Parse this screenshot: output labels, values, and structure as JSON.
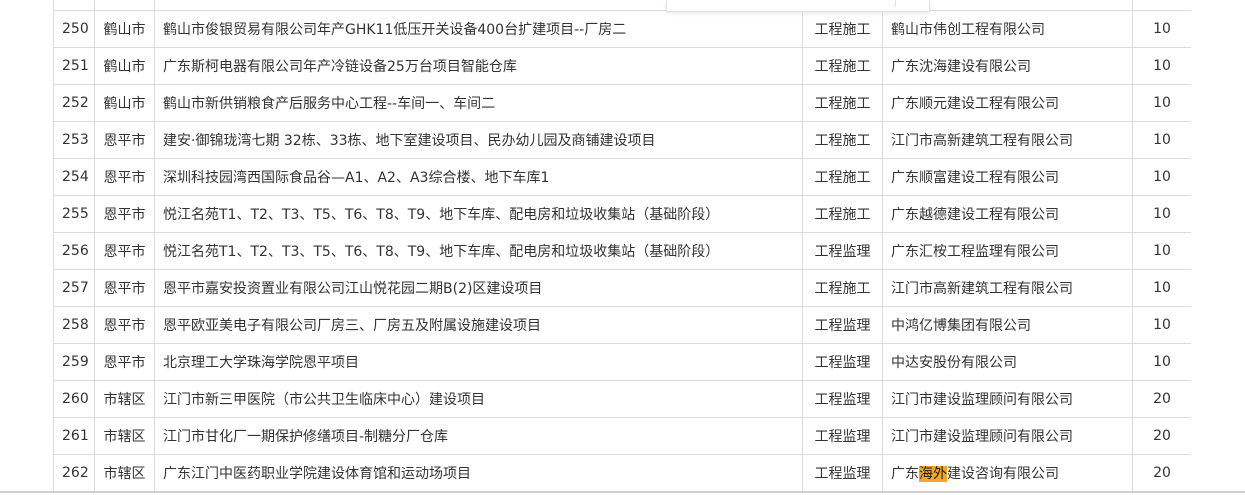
{
  "table": {
    "rows": [
      {
        "no": "250",
        "area": "鹤山市",
        "project": "鹤山市俊银贸易有限公司年产GHK11低压开关设备400台扩建项目--厂房二",
        "type": "工程施工",
        "company": "鹤山市伟创工程有限公司",
        "score": "10"
      },
      {
        "no": "251",
        "area": "鹤山市",
        "project": "广东斯柯电器有限公司年产冷链设备25万台项目智能仓库",
        "type": "工程施工",
        "company": "广东沈海建设有限公司",
        "score": "10"
      },
      {
        "no": "252",
        "area": "鹤山市",
        "project": "鹤山市新供销粮食产后服务中心工程--车间一、车间二",
        "type": "工程施工",
        "company": "广东顺元建设工程有限公司",
        "score": "10"
      },
      {
        "no": "253",
        "area": "恩平市",
        "project": "建安·御锦珑湾七期 32栋、33栋、地下室建设项目、民办幼儿园及商铺建设项目",
        "type": "工程施工",
        "company": "江门市高新建筑工程有限公司",
        "score": "10"
      },
      {
        "no": "254",
        "area": "恩平市",
        "project": "深圳科技园湾西国际食品谷—A1、A2、A3综合楼、地下车库1",
        "type": "工程施工",
        "company": "广东顺富建设工程有限公司",
        "score": "10"
      },
      {
        "no": "255",
        "area": "恩平市",
        "project": "悦江名苑T1、T2、T3、T5、T6、T8、T9、地下车库、配电房和垃圾收集站（基础阶段）",
        "type": "工程施工",
        "company": "广东越德建设工程有限公司",
        "score": "10"
      },
      {
        "no": "256",
        "area": "恩平市",
        "project": "悦江名苑T1、T2、T3、T5、T6、T8、T9、地下车库、配电房和垃圾收集站（基础阶段）",
        "type": "工程监理",
        "company": "广东汇桉工程监理有限公司",
        "score": "10"
      },
      {
        "no": "257",
        "area": "恩平市",
        "project": "恩平市嘉安投资置业有限公司江山悦花园二期B(2)区建设项目",
        "type": "工程施工",
        "company": "江门市高新建筑工程有限公司",
        "score": "10"
      },
      {
        "no": "258",
        "area": "恩平市",
        "project": "恩平欧亚美电子有限公司厂房三、厂房五及附属设施建设项目",
        "type": "工程监理",
        "company": "中鸿亿博集团有限公司",
        "score": "10"
      },
      {
        "no": "259",
        "area": "恩平市",
        "project": "北京理工大学珠海学院恩平项目",
        "type": "工程监理",
        "company": "中达安股份有限公司",
        "score": "10"
      },
      {
        "no": "260",
        "area": "市辖区",
        "project": "江门市新三甲医院（市公共卫生临床中心）建设项目",
        "type": "工程监理",
        "company": "江门市建设监理顾问有限公司",
        "score": "20"
      },
      {
        "no": "261",
        "area": "市辖区",
        "project": "江门市甘化厂一期保护修缮项目-制糖分厂仓库",
        "type": "工程监理",
        "company": "江门市建设监理顾问有限公司",
        "score": "20"
      },
      {
        "no": "262",
        "area": "市辖区",
        "project": "广东江门中医药职业学院建设体育馆和运动场项目",
        "type": "工程监理",
        "company_prefix": "广东",
        "company_highlight": "海外",
        "company_suffix": "建设咨询有限公司",
        "score": "20"
      }
    ]
  },
  "colors": {
    "border": "#dcdcdc",
    "text": "#333333",
    "search_highlight": "#f5a623"
  }
}
